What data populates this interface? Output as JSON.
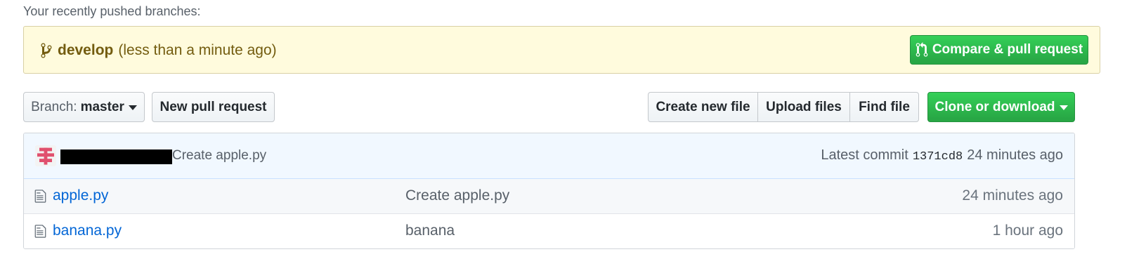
{
  "recent": {
    "label": "Your recently pushed branches:",
    "branch_name": "develop",
    "pushed_time": "(less than a minute ago)",
    "compare_button": "Compare & pull request"
  },
  "toolbar": {
    "branch_label": "Branch:",
    "branch_value": "master",
    "new_pr": "New pull request",
    "create_file": "Create new file",
    "upload_files": "Upload files",
    "find_file": "Find file",
    "clone_download": "Clone or download"
  },
  "commit": {
    "message": "Create apple.py",
    "latest_label": "Latest commit",
    "sha": "1371cd8",
    "time": "24 minutes ago"
  },
  "files": [
    {
      "name": "apple.py",
      "message": "Create apple.py",
      "age": "24 minutes ago"
    },
    {
      "name": "banana.py",
      "message": "banana",
      "age": "1 hour ago"
    }
  ],
  "colors": {
    "primary_green": "#28a745",
    "link_blue": "#0366d6",
    "banner_bg": "#fffbdd",
    "commit_bg": "#f1f8ff"
  },
  "icons": {
    "branch": "git-branch-icon",
    "pull_request": "git-pull-request-icon",
    "file": "file-icon",
    "avatar": "identicon-avatar"
  }
}
